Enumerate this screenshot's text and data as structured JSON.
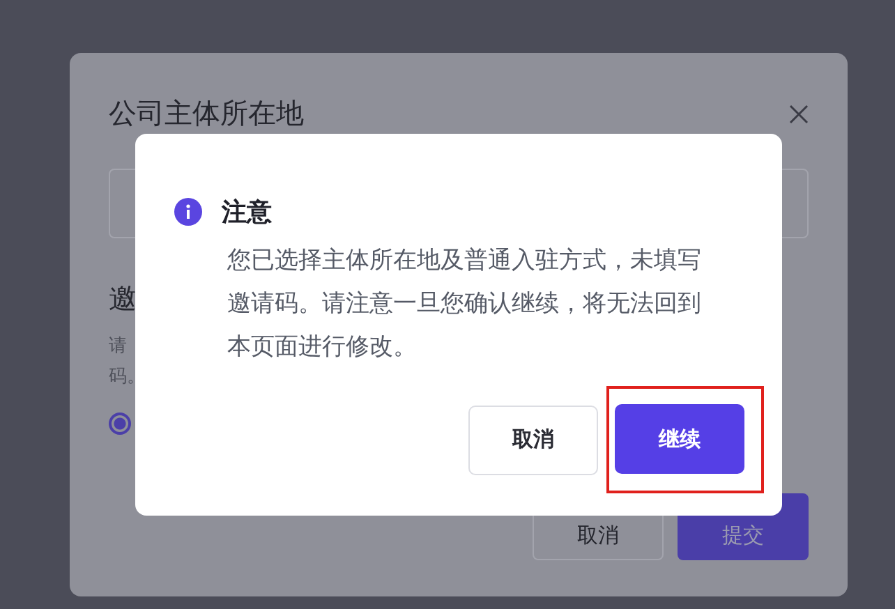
{
  "background_dialog": {
    "title": "公司主体所在地",
    "section_title": "邀",
    "hint_lines": [
      "请",
      "码。"
    ],
    "radio": {
      "selected": true
    },
    "buttons": [
      {
        "label": "取消",
        "kind": "secondary"
      },
      {
        "label": "提交",
        "kind": "primary"
      }
    ]
  },
  "alert": {
    "title": "注意",
    "message": "您已选择主体所在地及普通入驻方式，未填写邀请码。请注意一旦您确认继续，将无法回到本页面进行修改。",
    "buttons": [
      {
        "label": "取消",
        "kind": "secondary"
      },
      {
        "label": "继续",
        "kind": "primary",
        "highlighted": true
      }
    ]
  }
}
